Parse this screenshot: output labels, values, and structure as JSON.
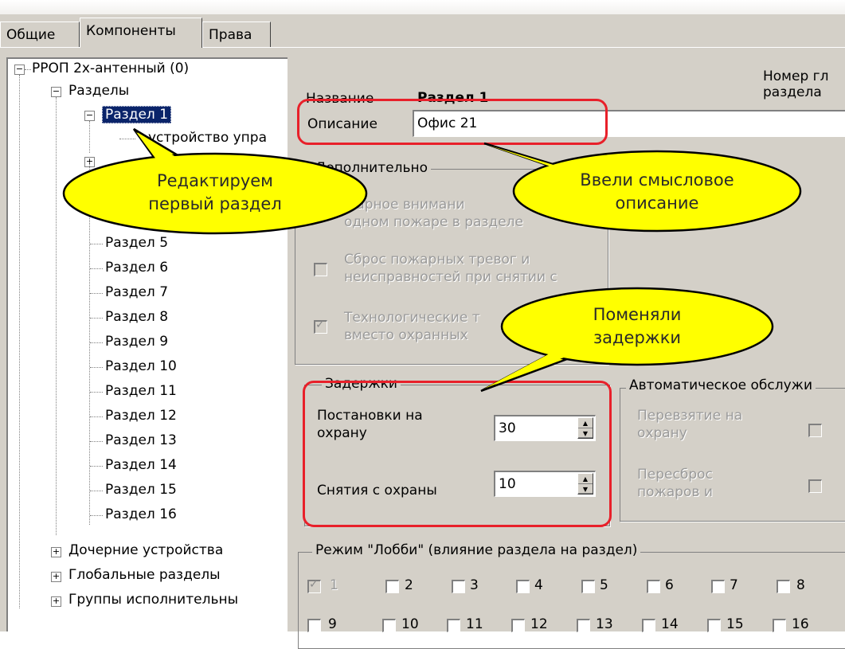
{
  "tabs": [
    "Общие",
    "Компоненты",
    "Права"
  ],
  "tree": {
    "root": "РРОП 2х-антенный (0)",
    "sections_group": "Разделы",
    "selected": "Раздел 1",
    "child_device": "устройство упра",
    "sections": [
      "Раздел 5",
      "Раздел 6",
      "Раздел 7",
      "Раздел 8",
      "Раздел 9",
      "Раздел 10",
      "Раздел 11",
      "Раздел 12",
      "Раздел 13",
      "Раздел 14",
      "Раздел 15",
      "Раздел 16"
    ],
    "bottom_items": [
      "Дочерние устройства",
      "Глобальные разделы",
      "Группы исполнительны"
    ]
  },
  "form": {
    "name_label": "Название",
    "name_value": "Раздел 1",
    "number_label_1": "Номер гл",
    "number_label_2": "раздела",
    "desc_label": "Описание",
    "desc_value": "Офис 21",
    "extra_title": "Дополнительно",
    "extra_1a": "жарное внимани",
    "extra_1b": "одном пожаре в разделе",
    "extra_2a": "Сброс пожарных тревог и",
    "extra_2b": "неисправностей при снятии с",
    "extra_3a": "Технологические т",
    "extra_3b": "вместо охранных",
    "delays_title": "Задержки",
    "arm_label_1": "Постановки на",
    "arm_label_2": "охрану",
    "arm_value": "30",
    "disarm_label": "Снятия с охраны",
    "disarm_value": "10",
    "auto_title": "Автоматическое обслужи",
    "auto_1a": "Перевзятие на",
    "auto_1b": "охрану",
    "auto_2a": "Пересброс",
    "auto_2b": "пожаров и",
    "lobby_title": "Режим \"Лобби\" (влияние раздела на раздел)",
    "lobby_row1": [
      "1",
      "2",
      "3",
      "4",
      "5",
      "6",
      "7",
      "8"
    ],
    "lobby_row2": [
      "9",
      "10",
      "11",
      "12",
      "13",
      "14",
      "15",
      "16"
    ]
  },
  "callouts": {
    "edit_1": "Редактируем",
    "edit_2": "первый раздел",
    "desc_1": "Ввели смысловое",
    "desc_2": "описание",
    "delay_1": "Поменяли",
    "delay_2": "задержки"
  },
  "colors": {
    "window": "#d4d0c8",
    "selection": "#0a246a",
    "callout": "#ffff00",
    "highlight": "#e8202a"
  }
}
